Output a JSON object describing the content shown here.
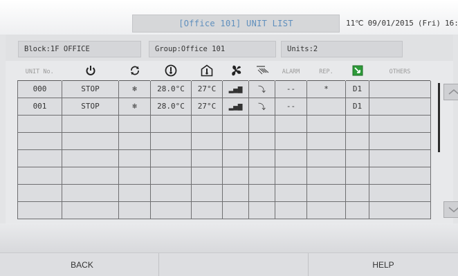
{
  "header": {
    "title": "[Office 101] UNIT LIST",
    "temperature": "11℃",
    "date": "09/01/2015",
    "weekday": "(Fri)",
    "time": "16:0"
  },
  "info": {
    "block": "Block:1F OFFICE",
    "group": "Group:Office 101",
    "units": "Units:2"
  },
  "table": {
    "headers": {
      "unit_no": "UNIT No.",
      "alarm": "ALARM",
      "rep": "REP.",
      "others": "OTHERS"
    },
    "header_icons": [
      "power-icon",
      "mode-icon",
      "setpoint-icon",
      "room-temp-icon",
      "fan-icon",
      "airflow-icon",
      "filter-icon"
    ],
    "rows": [
      {
        "unit": "000",
        "status": "STOP",
        "mode": "❄",
        "setpoint": "28.0°C",
        "room_temp": "27°C",
        "fan": "▂▄▆",
        "airflow": "⤵",
        "alarm": "--",
        "rep": "*",
        "filter": "D1",
        "others": ""
      },
      {
        "unit": "001",
        "status": "STOP",
        "mode": "❄",
        "setpoint": "28.0°C",
        "room_temp": "27°C",
        "fan": "▂▄▆",
        "airflow": "⤵",
        "alarm": "--",
        "rep": "",
        "filter": "D1",
        "others": ""
      }
    ],
    "empty_rows": 6
  },
  "colors": {
    "status_stop": "#3a8fd4",
    "title_text": "#5f8fbd",
    "filter_icon": "#2e9b3a"
  },
  "footer": {
    "back": "BACK",
    "middle": "",
    "help": "HELP"
  }
}
